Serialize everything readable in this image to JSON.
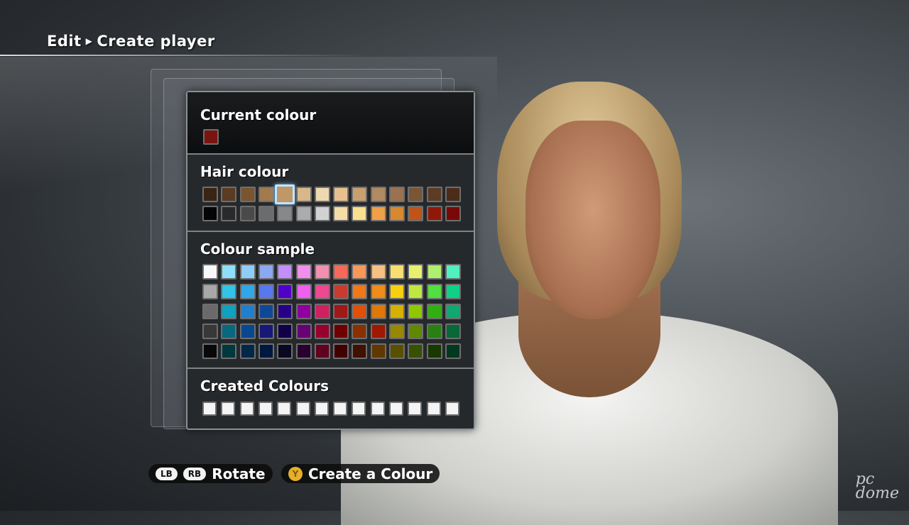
{
  "breadcrumb": {
    "parent": "Edit",
    "current": "Create player"
  },
  "panel": {
    "current_colour": {
      "title": "Current colour",
      "value": "#7a1410"
    },
    "hair_colour": {
      "title": "Hair colour",
      "selected_index": 4,
      "rows": [
        [
          "#3a2414",
          "#5a3c22",
          "#7a5530",
          "#a37a4e",
          "#c09868",
          "#d8b888",
          "#eed8b0",
          "#e8c090",
          "#c8a070",
          "#b08a62",
          "#9a7252",
          "#7a5536",
          "#5c3c24",
          "#4a2c18"
        ],
        [
          "#050505",
          "#2a2a2a",
          "#4a4a4a",
          "#6c6c6c",
          "#888888",
          "#acacac",
          "#d2d2d2",
          "#f4dca8",
          "#f8e090",
          "#f0a048",
          "#d88830",
          "#c05418",
          "#901808",
          "#7a0808"
        ]
      ]
    },
    "colour_sample": {
      "title": "Colour sample",
      "rows": [
        [
          "#f8f8f8",
          "#8ee0f8",
          "#90ccf8",
          "#8ca8f0",
          "#c090f8",
          "#f090ec",
          "#f090b0",
          "#f86858",
          "#f89858",
          "#f8c080",
          "#f8e070",
          "#e8f070",
          "#b0f070",
          "#50f0c0"
        ],
        [
          "#a8a8a8",
          "#30c4e8",
          "#30a8e8",
          "#5878f0",
          "#5000c8",
          "#f060f0",
          "#f04890",
          "#c83c30",
          "#f07818",
          "#f08c18",
          "#f8d010",
          "#c0e840",
          "#50e040",
          "#10d088"
        ],
        [
          "#6a6a6a",
          "#10a0c0",
          "#2080d0",
          "#104898",
          "#280088",
          "#9000a0",
          "#d02060",
          "#a01818",
          "#e05008",
          "#e07808",
          "#d8b000",
          "#90c800",
          "#30b010",
          "#10a870"
        ],
        [
          "#383838",
          "#086880",
          "#084890",
          "#181878",
          "#10004a",
          "#680078",
          "#980030",
          "#700000",
          "#883000",
          "#a01800",
          "#988800",
          "#608800",
          "#288010",
          "#086838"
        ],
        [
          "#080808",
          "#003840",
          "#002848",
          "#001840",
          "#080820",
          "#280030",
          "#600020",
          "#400000",
          "#401000",
          "#603800",
          "#585000",
          "#385000",
          "#183800",
          "#003820"
        ]
      ]
    },
    "created_colours": {
      "title": "Created Colours",
      "rows": [
        [
          "#f4f4f4",
          "#f4f4f4",
          "#f4f4f4",
          "#f4f4f4",
          "#f4f4f4",
          "#f4f4f4",
          "#f4f4f4",
          "#f4f4f4",
          "#f4f4f4",
          "#f4f4f4",
          "#f4f4f4",
          "#f4f4f4",
          "#f4f4f4",
          "#f4f4f4"
        ]
      ]
    }
  },
  "hints": {
    "lb": "LB",
    "rb": "RB",
    "rotate": "Rotate",
    "y": "Y",
    "create": "Create a Colour"
  },
  "watermark": "PC dome"
}
